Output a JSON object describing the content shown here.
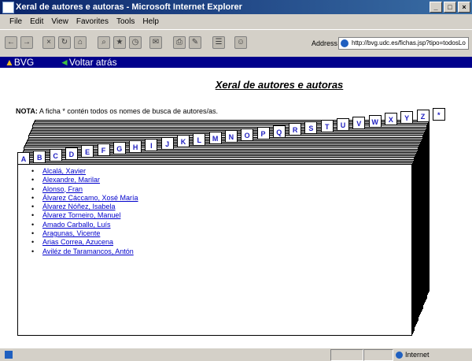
{
  "window": {
    "title": "Xeral de autores e autoras - Microsoft Internet Explorer"
  },
  "menu": [
    "File",
    "Edit",
    "View",
    "Favorites",
    "Tools",
    "Help"
  ],
  "toolbar": {
    "address_label": "Address",
    "address_value": "http://bvg.udc.es/fichas.jsp?tipo=todosLo"
  },
  "nav": {
    "bvg": "BVG",
    "back": "Voltar atrás"
  },
  "page": {
    "title": "Xeral de autores e autoras",
    "note_label": "NOTA:",
    "note_text": " A ficha * contén todos os nomes de busca de autores/as."
  },
  "tabs": [
    "A",
    "B",
    "C",
    "D",
    "E",
    "F",
    "G",
    "H",
    "I",
    "J",
    "K",
    "L",
    "M",
    "N",
    "O",
    "P",
    "Q",
    "R",
    "S",
    "T",
    "U",
    "V",
    "W",
    "X",
    "Y",
    "Z",
    "*"
  ],
  "authors": [
    "Alcalá, Xavier",
    "Alexandre, Marilar",
    "Alonso, Fran",
    "Álvarez Cáccamo, Xosé María",
    "Álvarez Nóñez, Isabela",
    "Álvarez Torneiro, Manuel",
    "Amado Carballo, Luís",
    "Aragunas, Vicente",
    "Arias Correa, Azucena",
    "Aviléz de Taramancos, Antón"
  ],
  "status": {
    "zone": "Internet"
  },
  "icons": [
    "ie-logo-icon",
    "back-arrow-icon",
    "forward-arrow-icon",
    "stop-icon",
    "refresh-icon",
    "home-icon",
    "search-icon",
    "favorites-icon",
    "history-icon",
    "mail-icon",
    "print-icon",
    "edit-icon",
    "discuss-icon",
    "messenger-icon"
  ]
}
